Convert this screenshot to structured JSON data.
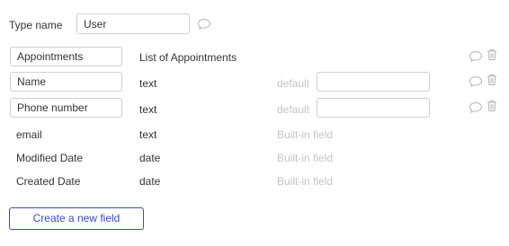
{
  "type_name": {
    "label": "Type name",
    "value": "User"
  },
  "fields": [
    {
      "name": "Appointments",
      "type": "List of Appointments",
      "default_label": "",
      "default_value": "",
      "builtin": false,
      "editable_name": true,
      "has_default_input": false
    },
    {
      "name": "Name",
      "type": "text",
      "default_label": "default",
      "default_value": "",
      "builtin": false,
      "editable_name": true,
      "has_default_input": true
    },
    {
      "name": "Phone number",
      "type": "text",
      "default_label": "default",
      "default_value": "",
      "builtin": false,
      "editable_name": true,
      "has_default_input": true
    },
    {
      "name": "email",
      "type": "text",
      "default_label": "Built-in field",
      "builtin": true
    },
    {
      "name": "Modified Date",
      "type": "date",
      "default_label": "Built-in field",
      "builtin": true
    },
    {
      "name": "Created Date",
      "type": "date",
      "default_label": "Built-in field",
      "builtin": true
    }
  ],
  "create_button": {
    "label": "Create a new field"
  },
  "colors": {
    "accent": "#3b4bc8",
    "muted_text": "#c4c4c4",
    "border": "#cfcfcf"
  },
  "icons": {
    "comment": "comment-icon",
    "delete": "trash-icon"
  }
}
